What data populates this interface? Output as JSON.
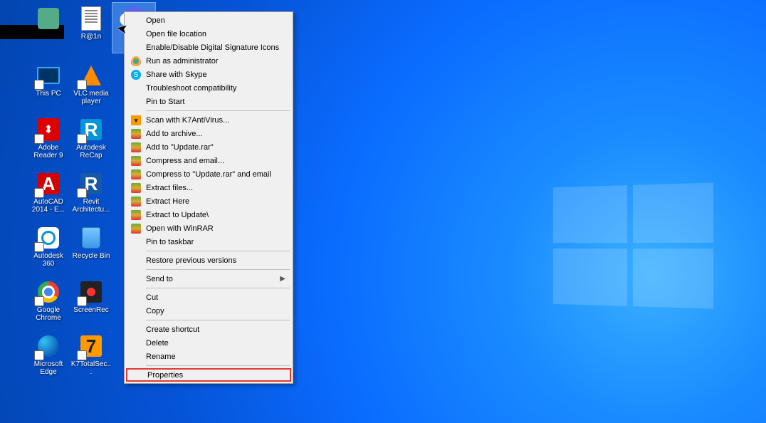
{
  "desktop_icons": {
    "row0": [
      {
        "label": "",
        "type": "user"
      },
      {
        "label": "R@1n",
        "type": "text"
      },
      {
        "label": "",
        "type": "discord",
        "selected": true
      }
    ],
    "col1": [
      {
        "label": "This PC",
        "type": "pc"
      },
      {
        "label": "Adobe Reader 9",
        "type": "pdf"
      },
      {
        "label": "AutoCAD 2014 - E...",
        "type": "acad"
      },
      {
        "label": "Autodesk 360",
        "type": "a360"
      },
      {
        "label": "Google Chrome",
        "type": "chrome"
      },
      {
        "label": "Microsoft Edge",
        "type": "edge"
      }
    ],
    "col2": [
      {
        "label": "VLC media player",
        "type": "vlc"
      },
      {
        "label": "Autodesk ReCap",
        "type": "autodesk"
      },
      {
        "label": "Revit Architectu...",
        "type": "revit"
      },
      {
        "label": "Recycle Bin",
        "type": "bin"
      },
      {
        "label": "ScreenRec",
        "type": "screenrec"
      },
      {
        "label": "K7TotalSec...",
        "type": "k7"
      }
    ]
  },
  "context_menu": {
    "groups": [
      [
        {
          "label": "Open",
          "icon": ""
        },
        {
          "label": "Open file location",
          "icon": ""
        },
        {
          "label": "Enable/Disable Digital Signature Icons",
          "icon": ""
        },
        {
          "label": "Run as administrator",
          "icon": "shield"
        },
        {
          "label": "Share with Skype",
          "icon": "skype"
        },
        {
          "label": "Troubleshoot compatibility",
          "icon": ""
        },
        {
          "label": "Pin to Start",
          "icon": ""
        }
      ],
      [
        {
          "label": "Scan with K7AntiVirus...",
          "icon": "k7"
        },
        {
          "label": "Add to archive...",
          "icon": "rar"
        },
        {
          "label": "Add to \"Update.rar\"",
          "icon": "rar"
        },
        {
          "label": "Compress and email...",
          "icon": "rar"
        },
        {
          "label": "Compress to \"Update.rar\" and email",
          "icon": "rar"
        },
        {
          "label": "Extract files...",
          "icon": "rar"
        },
        {
          "label": "Extract Here",
          "icon": "rar"
        },
        {
          "label": "Extract to Update\\",
          "icon": "rar"
        },
        {
          "label": "Open with WinRAR",
          "icon": "rar"
        },
        {
          "label": "Pin to taskbar",
          "icon": ""
        }
      ],
      [
        {
          "label": "Restore previous versions",
          "icon": ""
        }
      ],
      [
        {
          "label": "Send to",
          "icon": "",
          "submenu": true
        }
      ],
      [
        {
          "label": "Cut",
          "icon": ""
        },
        {
          "label": "Copy",
          "icon": ""
        }
      ],
      [
        {
          "label": "Create shortcut",
          "icon": ""
        },
        {
          "label": "Delete",
          "icon": ""
        },
        {
          "label": "Rename",
          "icon": ""
        }
      ],
      [
        {
          "label": "Properties",
          "icon": "",
          "highlight": true
        }
      ]
    ]
  }
}
